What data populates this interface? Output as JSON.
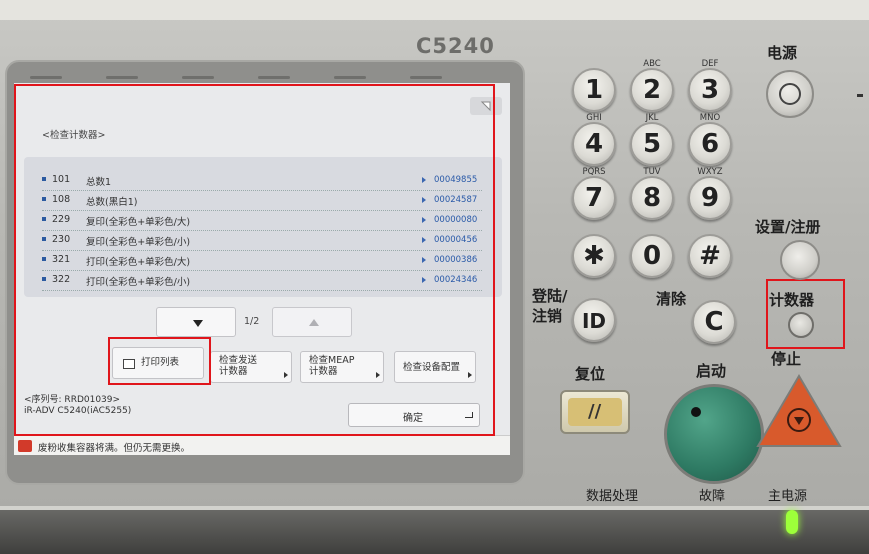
{
  "device": {
    "model": "C5240"
  },
  "screen": {
    "title": "<检查计数器>",
    "counters": [
      {
        "code": "101",
        "label": "总数1",
        "value": "00049855"
      },
      {
        "code": "108",
        "label": "总数(黑白1)",
        "value": "00024587"
      },
      {
        "code": "229",
        "label": "复印(全彩色+单彩色/大)",
        "value": "00000080"
      },
      {
        "code": "230",
        "label": "复印(全彩色+单彩色/小)",
        "value": "00000456"
      },
      {
        "code": "321",
        "label": "打印(全彩色+单彩色/大)",
        "value": "00000386"
      },
      {
        "code": "322",
        "label": "打印(全彩色+单彩色/小)",
        "value": "00024346"
      }
    ],
    "page_indicator": "1/2",
    "buttons": {
      "print_list": "打印列表",
      "check_send_line1": "检查发送",
      "check_send_line2": "计数器",
      "check_meap_line1": "检查MEAP",
      "check_meap_line2": "计数器",
      "check_device_config": "检查设备配置",
      "ok": "确定"
    },
    "serial_line1": "<序列号: RRD01039>",
    "serial_line2": "iR-ADV C5240(iAC5255)",
    "status_message": "废粉收集容器将满。但仍无需更换。"
  },
  "keypad": {
    "keys": [
      {
        "digit": "1",
        "sub": ""
      },
      {
        "digit": "2",
        "sub": "ABC"
      },
      {
        "digit": "3",
        "sub": "DEF"
      },
      {
        "digit": "4",
        "sub": "GHI"
      },
      {
        "digit": "5",
        "sub": "JKL"
      },
      {
        "digit": "6",
        "sub": "MNO"
      },
      {
        "digit": "7",
        "sub": "PQRS"
      },
      {
        "digit": "8",
        "sub": "TUV"
      },
      {
        "digit": "9",
        "sub": "WXYZ"
      },
      {
        "digit": "✱",
        "sub": ""
      },
      {
        "digit": "0",
        "sub": ""
      },
      {
        "digit": "#",
        "sub": ""
      }
    ],
    "id_key": "ID",
    "clear_key": "C"
  },
  "labels": {
    "power": "电源",
    "settings": "设置/注册",
    "login_line1": "登陆/",
    "login_line2": "注销",
    "clear": "清除",
    "counter": "计数器",
    "reset": "复位",
    "start": "启动",
    "stop": "停止",
    "data_processing": "数据处理",
    "error": "故障",
    "main_power": "主电源"
  },
  "colors": {
    "annotation_red": "#e0151b",
    "start_green": "#2e7a63",
    "stop_orange": "#d85a2c",
    "status_led": "#9dff3a"
  }
}
